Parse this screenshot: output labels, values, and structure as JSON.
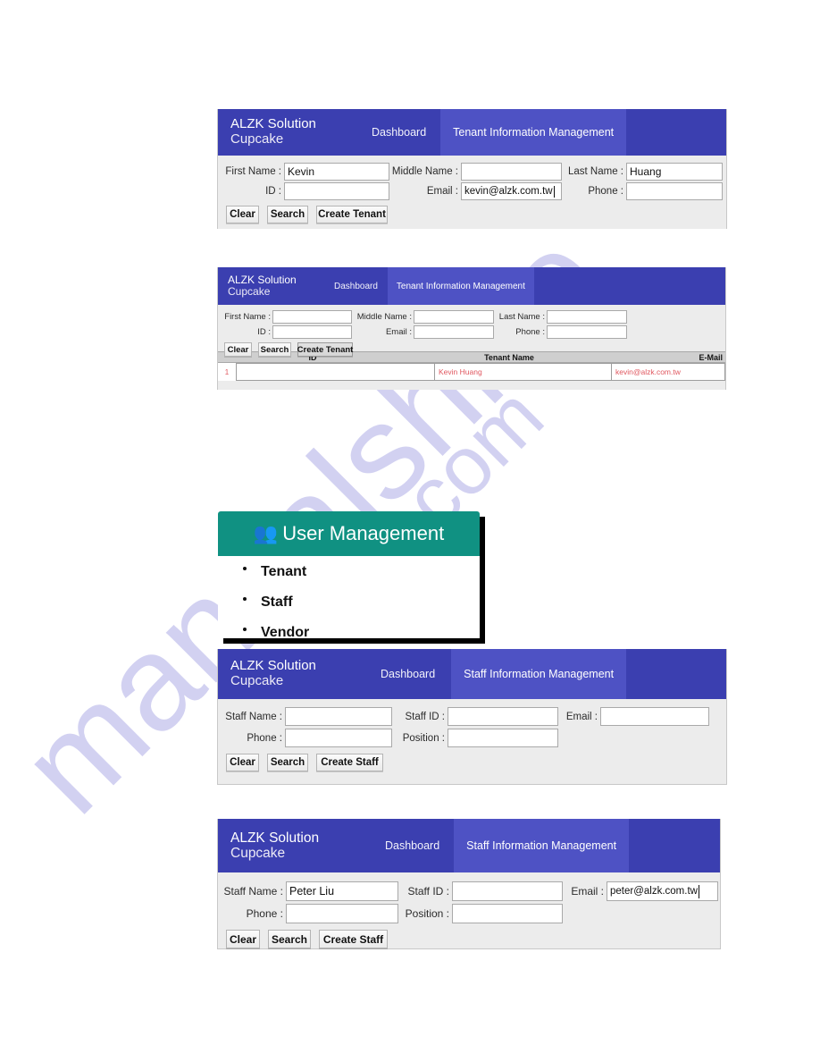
{
  "page": {
    "watermark_line1": "manualshive",
    "watermark_line2": "e.com"
  },
  "brand": {
    "line1": "ALZK Solution",
    "line2": "Cupcake"
  },
  "colors": {
    "appbar": "#3b3fb0",
    "active_tab": "#4e52c4",
    "panel_bg": "#ececec",
    "user_management_header": "#109182",
    "result_text": "#e0575f",
    "table_header_bg": "#cfcfcf"
  },
  "nav": {
    "dashboard": "Dashboard",
    "tenant_tab": "Tenant Information Management",
    "staff_tab": "Staff Information Management"
  },
  "tenant_panel_filled": {
    "fields": {
      "first_name_label": "First Name :",
      "first_name_value": "Kevin",
      "middle_name_label": "Middle Name :",
      "middle_name_value": "",
      "last_name_label": "Last Name :",
      "last_name_value": "Huang",
      "id_label": "ID :",
      "id_value": "",
      "email_label": "Email :",
      "email_value": "kevin@alzk.com.tw",
      "phone_label": "Phone :",
      "phone_value": ""
    },
    "buttons": {
      "clear": "Clear",
      "search": "Search",
      "create": "Create Tenant"
    }
  },
  "tenant_panel_results": {
    "fields": {
      "first_name_label": "First Name :",
      "first_name_value": "",
      "middle_name_label": "Middle Name :",
      "middle_name_value": "",
      "last_name_label": "Last Name :",
      "last_name_value": "",
      "id_label": "ID :",
      "id_value": "",
      "email_label": "Email :",
      "email_value": "",
      "phone_label": "Phone :",
      "phone_value": ""
    },
    "buttons": {
      "clear": "Clear",
      "search": "Search",
      "create": "Create Tenant"
    },
    "table": {
      "headers": [
        "ID",
        "Tenant Name",
        "E-Mail"
      ],
      "rows": [
        {
          "marker": "1",
          "id": "",
          "tenant_name": "Kevin Huang",
          "email": "kevin@alzk.com.tw"
        }
      ]
    }
  },
  "user_management": {
    "title": "User Management",
    "icon": "people-icon",
    "items": [
      "Tenant",
      "Staff",
      "Vendor"
    ]
  },
  "staff_panel_empty": {
    "fields": {
      "staff_name_label": "Staff Name :",
      "staff_name_value": "",
      "staff_id_label": "Staff ID :",
      "staff_id_value": "",
      "email_label": "Email :",
      "email_value": "",
      "phone_label": "Phone :",
      "phone_value": "",
      "position_label": "Position :",
      "position_value": ""
    },
    "buttons": {
      "clear": "Clear",
      "search": "Search",
      "create": "Create Staff"
    }
  },
  "staff_panel_filled": {
    "fields": {
      "staff_name_label": "Staff Name :",
      "staff_name_value": "Peter Liu",
      "staff_id_label": "Staff ID :",
      "staff_id_value": "",
      "email_label": "Email :",
      "email_value": "peter@alzk.com.tw",
      "phone_label": "Phone :",
      "phone_value": "",
      "position_label": "Position :",
      "position_value": ""
    },
    "buttons": {
      "clear": "Clear",
      "search": "Search",
      "create": "Create Staff"
    }
  }
}
